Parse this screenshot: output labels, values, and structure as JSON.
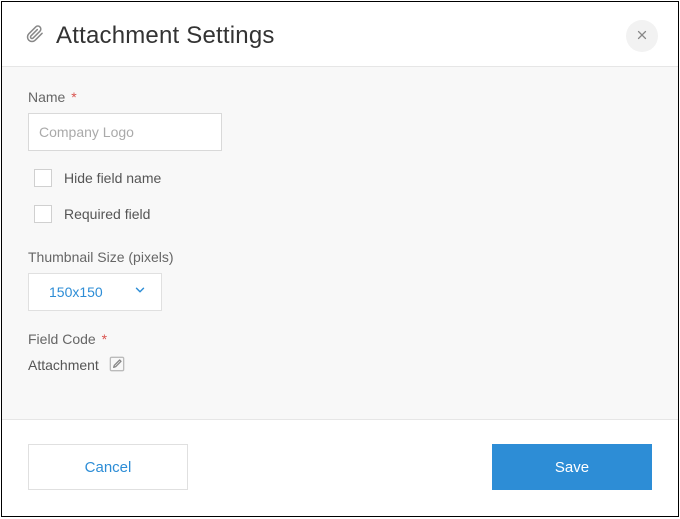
{
  "header": {
    "title": "Attachment Settings"
  },
  "form": {
    "name": {
      "label": "Name",
      "required_marker": "*",
      "value": "Company Logo"
    },
    "hide_field_name": {
      "label": "Hide field name",
      "checked": false
    },
    "required_field": {
      "label": "Required field",
      "checked": false
    },
    "thumbnail_size": {
      "label": "Thumbnail Size (pixels)",
      "value": "150x150"
    },
    "field_code": {
      "label": "Field Code",
      "required_marker": "*",
      "value": "Attachment"
    }
  },
  "footer": {
    "cancel": "Cancel",
    "save": "Save"
  }
}
